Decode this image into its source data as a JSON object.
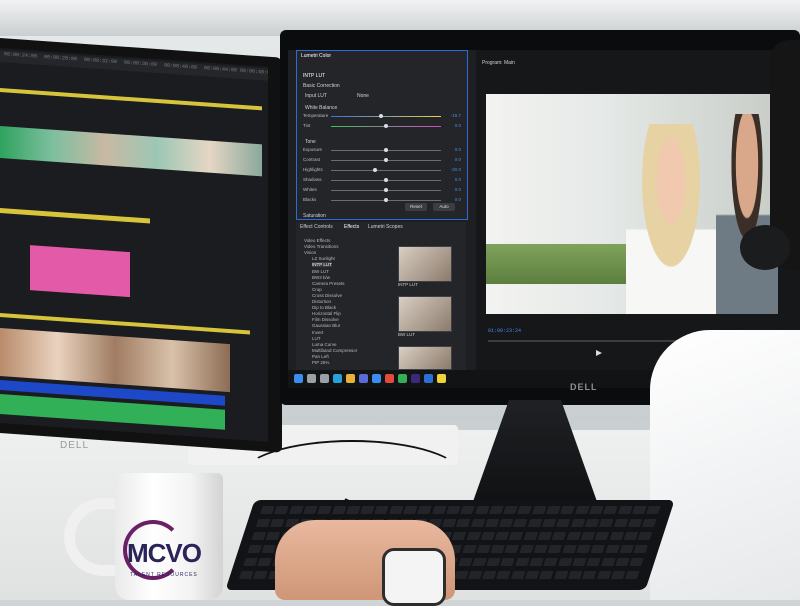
{
  "left_monitor": {
    "brand": "DELL",
    "ruler_ticks": [
      "00:00:24:00",
      "00:00:28:00",
      "00:00:32:00",
      "00:00:36:00",
      "00:00:40:00",
      "00:00:44:00",
      "00:00:48:00"
    ]
  },
  "right_monitor": {
    "brand": "DELL",
    "lumetri": {
      "tab_title": "Lumetri Color",
      "preset_label": "INTP LUT",
      "section": "Basic Correction",
      "input_lut_label": "Input LUT",
      "input_lut_value": "None",
      "white_balance_label": "White Balance",
      "sliders": [
        {
          "label": "Temperature",
          "value": "-15.7",
          "level": 0.45
        },
        {
          "label": "Tint",
          "value": "0.0",
          "level": 0.5
        },
        {
          "label": "Exposure",
          "value": "0.0",
          "level": 0.5
        },
        {
          "label": "Contrast",
          "value": "0.0",
          "level": 0.5
        },
        {
          "label": "Highlights",
          "value": "-20.0",
          "level": 0.4
        },
        {
          "label": "Shadows",
          "value": "0.0",
          "level": 0.5
        },
        {
          "label": "Whites",
          "value": "0.0",
          "level": 0.5
        },
        {
          "label": "Blacks",
          "value": "0.0",
          "level": 0.5
        }
      ],
      "tone_label": "Tone",
      "reset_button": "Reset",
      "auto_button": "Auto",
      "saturation_label": "Saturation"
    },
    "effects": {
      "tabs": [
        "Effect Controls",
        "Effects",
        "Lumetri Scopes"
      ],
      "items": [
        "Video Effects",
        "Video Transitions",
        "Vision",
        "LZ Sunlight",
        "INTP LUT",
        "BW LUT",
        "BW3 b/w",
        "Camera Presets",
        "Crop",
        "Cross Dissolve",
        "Distortion",
        "Dip to Black",
        "Horizontal Flip",
        "Film Dissolve",
        "Gaussian Blur",
        "Invert",
        "LUT",
        "Luma Curve",
        "Multiband Compressor",
        "Pan Left",
        "PIP 25%"
      ],
      "thumb_labels": [
        "INTP LUT",
        "BW LUT",
        ""
      ]
    },
    "program": {
      "title": "Program: Main",
      "timecode": "01:00:23:24"
    },
    "taskbar_icons": [
      "windows-icon",
      "search-icon",
      "taskview-icon",
      "edge-icon",
      "explorer-icon",
      "store-icon",
      "mail-icon",
      "chrome-icon",
      "spotify-icon",
      "premiere-icon",
      "photoshop-icon",
      "sticky-icon"
    ]
  },
  "mug": {
    "logo_text": "MCVO",
    "tagline": "TALENT RESOURCES"
  },
  "colors": {
    "accent_blue": "#2d6bd8",
    "timeline_pink": "#e25aa8",
    "timeline_green": "#31b058",
    "timeline_yellow": "#d7c43b",
    "timeline_blue": "#1d49c9",
    "mug_purple": "#6a1f67",
    "mug_navy": "#2a2458"
  }
}
